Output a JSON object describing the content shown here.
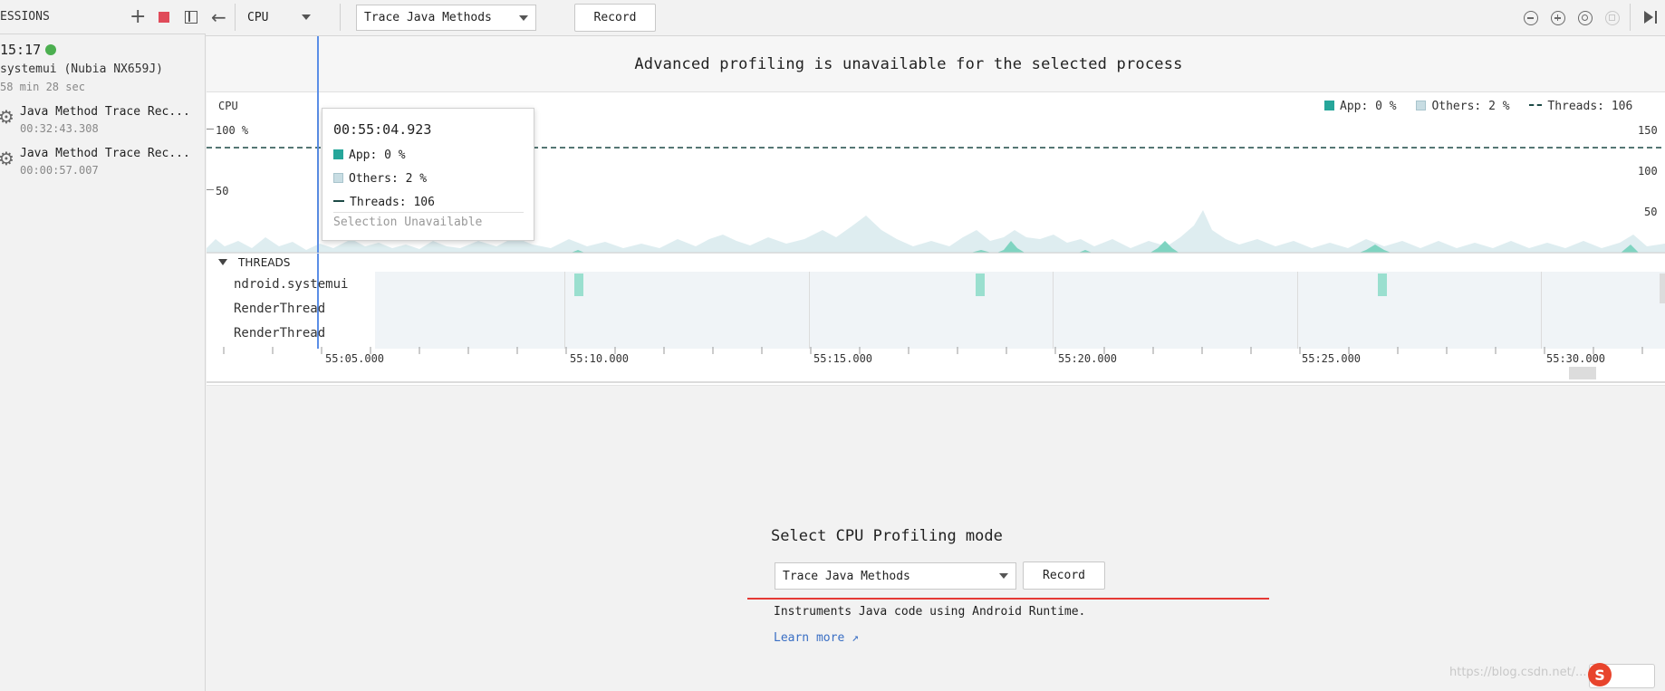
{
  "sessions": {
    "header_label": "ESSIONS",
    "session_time": "15:17",
    "session_process": "systemui (Nubia NX659J)",
    "session_duration": "58 min 28 sec",
    "traces": [
      {
        "name": "Java Method Trace Rec...",
        "time": "00:32:43.308"
      },
      {
        "name": "Java Method Trace Rec...",
        "time": "00:00:57.007"
      }
    ]
  },
  "toolbar": {
    "profiler": "CPU",
    "mode": "Trace Java Methods",
    "record_label": "Record"
  },
  "banner": "Advanced profiling is unavailable for the selected process",
  "cpu": {
    "label": "CPU",
    "y_left": [
      "100 %",
      "50"
    ],
    "y_right": [
      "150",
      "100",
      "50"
    ],
    "legend": {
      "app": "App: 0 %",
      "others": "Others: 2 %",
      "threads": "Threads: 106"
    },
    "colors": {
      "app": "#26a69a",
      "others": "#c8dde3",
      "threads": "#1d4a46"
    }
  },
  "tooltip": {
    "time": "00:55:04.923",
    "app": "App: 0 %",
    "others": "Others: 2 %",
    "threads": "Threads: 106",
    "footer": "Selection Unavailable"
  },
  "threads": {
    "header": "THREADS",
    "items": [
      "ndroid.systemui",
      "RenderThread",
      "RenderThread"
    ]
  },
  "timeline": {
    "ticks": [
      "55:05.000",
      "55:10.000",
      "55:15.000",
      "55:20.000",
      "55:25.000",
      "55:30.000"
    ]
  },
  "config": {
    "title": "Select CPU Profiling mode",
    "mode": "Trace Java Methods",
    "record_label": "Record",
    "description": "Instruments Java code using Android Runtime.",
    "learn_more": "Learn more ↗"
  },
  "watermark": "https://blog.csdn.net/..."
}
